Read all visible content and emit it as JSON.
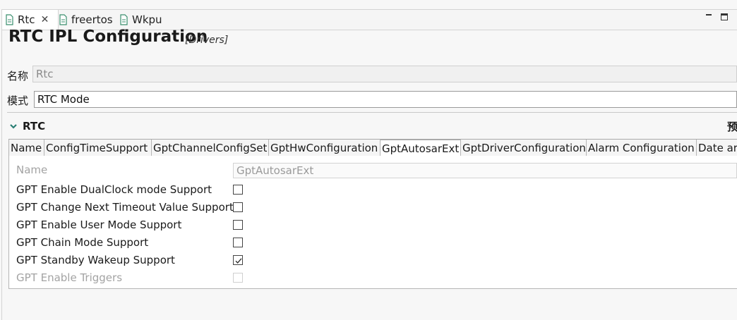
{
  "editor_tabs": [
    {
      "label": "Rtc",
      "active": true,
      "closable": true,
      "icon": "file-icon"
    },
    {
      "label": "freertos",
      "active": false,
      "icon": "file-icon"
    },
    {
      "label": "Wkpu",
      "active": false,
      "icon": "file-icon"
    }
  ],
  "window_controls": {
    "minimize_icon": "minimize-icon",
    "maximize_icon": "maximize-icon"
  },
  "page": {
    "title": "RTC IPL Configuration",
    "subtitle": "[Drivers]"
  },
  "fields": {
    "name_label": "名称",
    "name_value": "Rtc",
    "mode_label": "模式",
    "mode_value": "RTC Mode"
  },
  "section": {
    "label": "RTC",
    "extra": "预",
    "expanded": true
  },
  "config_tabs": [
    {
      "label": "Name"
    },
    {
      "label": "ConfigTimeSupport"
    },
    {
      "label": "GptChannelConfigSet"
    },
    {
      "label": "GptHwConfiguration"
    },
    {
      "label": "GptAutosarExt",
      "active": true
    },
    {
      "label": "GptDriverConfiguration"
    },
    {
      "label": "Alarm Configuration"
    },
    {
      "label": "Date ar"
    }
  ],
  "properties": {
    "name_label": "Name",
    "name_value": "GptAutosarExt",
    "rows": [
      {
        "label": "GPT Enable DualClock mode Support",
        "checked": false,
        "enabled": true
      },
      {
        "label": "GPT Change Next Timeout Value Support",
        "checked": false,
        "enabled": true
      },
      {
        "label": "GPT Enable User Mode Support",
        "checked": false,
        "enabled": true
      },
      {
        "label": "GPT Chain Mode Support",
        "checked": false,
        "enabled": true
      },
      {
        "label": "GPT Standby Wakeup Support",
        "checked": true,
        "enabled": true
      },
      {
        "label": "GPT Enable Triggers",
        "checked": false,
        "enabled": false
      }
    ]
  },
  "colors": {
    "accent": "#2a7f74",
    "disabled_text": "#a3a3a3"
  }
}
